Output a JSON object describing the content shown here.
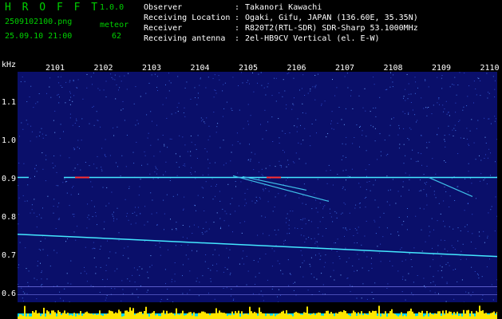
{
  "header": {
    "app_title": "H R O F F T",
    "app_version": "1.0.0",
    "filename": "2509102100.png",
    "meteor_label": "meteor",
    "datetime": "25.09.10 21:00",
    "meteor_count": "62",
    "info": [
      {
        "key": "Observer",
        "value": "Takanori Kawachi"
      },
      {
        "key": "Receiving Location",
        "value": "Ogaki, Gifu, JAPAN (136.60E, 35.35N)"
      },
      {
        "key": "Receiver",
        "value": "R820T2(RTL-SDR) SDR-Sharp 53.1000MHz"
      },
      {
        "key": "Receiving antenna",
        "value": "2el-HB9CV Vertical (el. E-W)"
      }
    ]
  },
  "chart_data": {
    "type": "heatmap",
    "ylabel": "kHz",
    "x_ticks": [
      "2101",
      "2102",
      "2103",
      "2104",
      "2105",
      "2106",
      "2107",
      "2108",
      "2109",
      "2110"
    ],
    "y_ticks": [
      "1.1",
      "1.0",
      "0.9",
      "0.8",
      "0.7",
      "0.6"
    ],
    "ylim": [
      0.58,
      1.18
    ],
    "carrier_khz": 0.905,
    "drift_line_khz": {
      "start": 0.757,
      "end": 0.699
    },
    "colors": {
      "background": "#0a0f6a",
      "signal": "#44e8ff",
      "bright": "#ff3030",
      "activity": "#ffe600",
      "activity_base": "#00d8ff"
    }
  }
}
